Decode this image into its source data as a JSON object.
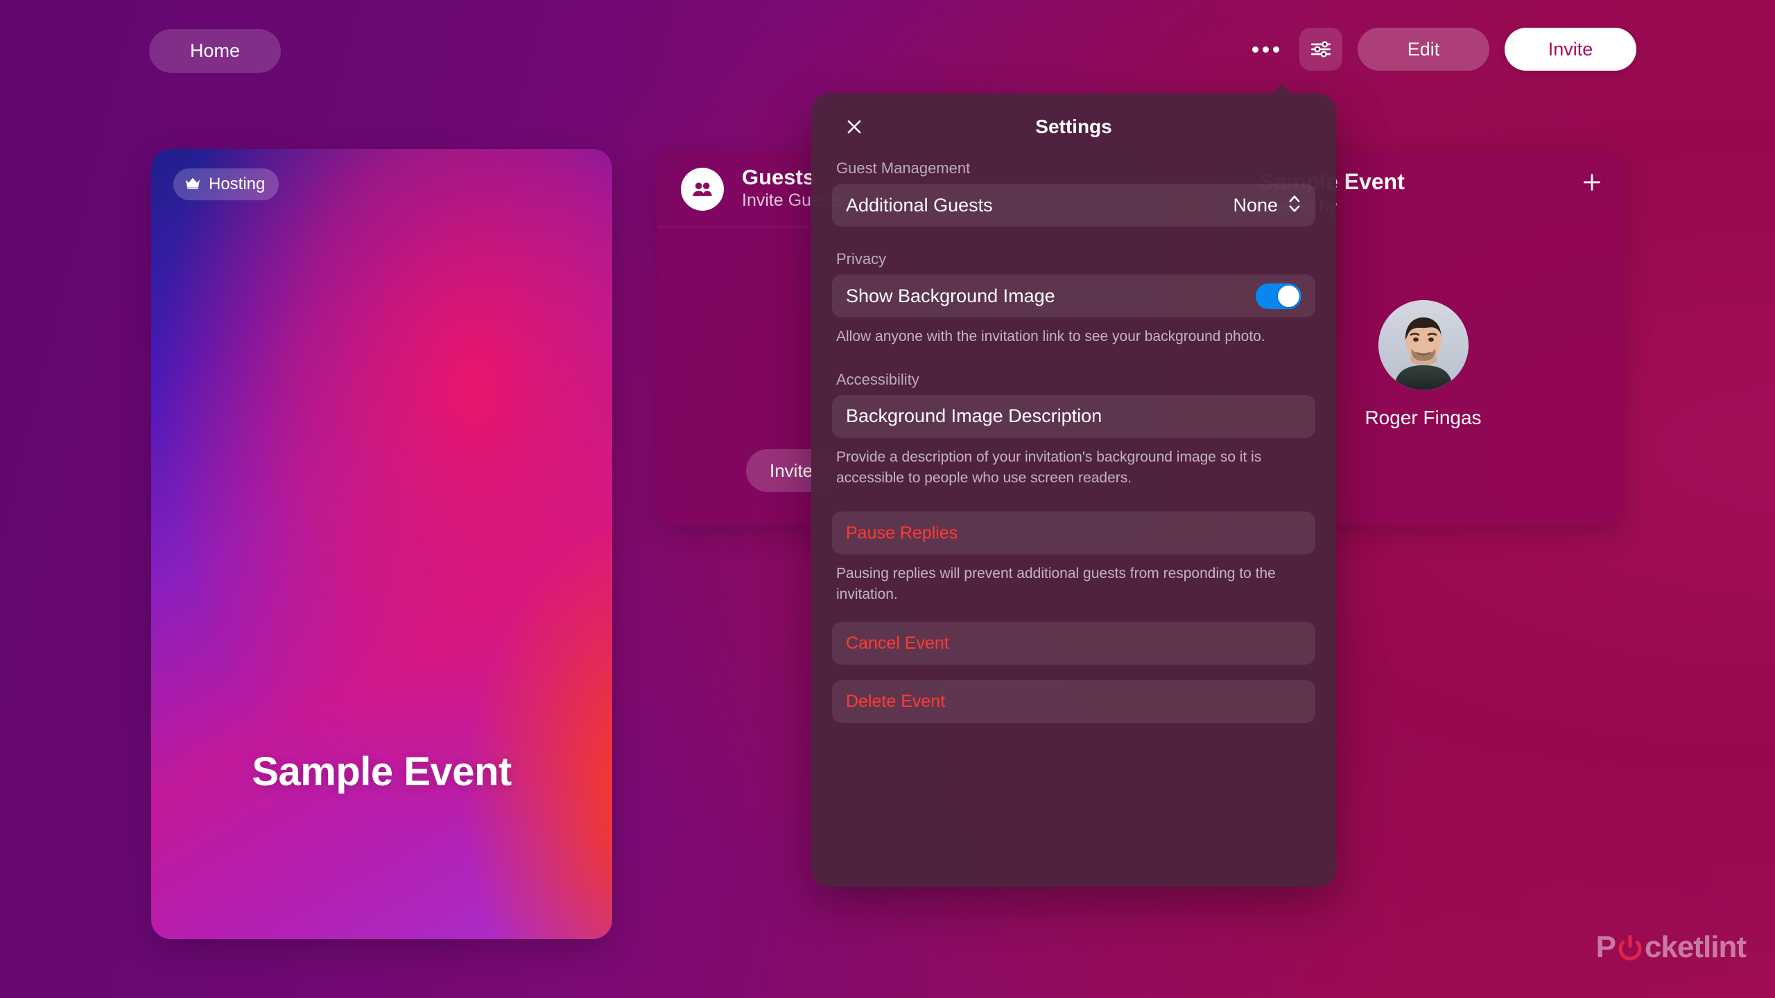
{
  "topbar": {
    "home_label": "Home",
    "more_icon": "ellipsis-icon",
    "sliders_icon": "sliders-icon",
    "edit_label": "Edit",
    "invite_label": "Invite"
  },
  "event_card": {
    "badge_label": "Hosting",
    "badge_icon": "crown-icon",
    "title": "Sample Event"
  },
  "guests_card": {
    "icon": "people-icon",
    "title": "Guests",
    "subtitle": "Invite Guests",
    "cta_label": "Invite"
  },
  "right_card": {
    "title": "Sample Event",
    "subtitle": "Hosted by",
    "add_icon": "plus-icon",
    "host_name": "Roger Fingas"
  },
  "settings_panel": {
    "title": "Settings",
    "close_icon": "close-icon",
    "sections": {
      "guest_management": {
        "label": "Guest Management",
        "row_label": "Additional Guests",
        "row_value": "None",
        "stepper_icon": "chevron-up-down-icon"
      },
      "privacy": {
        "label": "Privacy",
        "row_label": "Show Background Image",
        "toggle_state": "on",
        "helper": "Allow anyone with the invitation link to see your background photo."
      },
      "accessibility": {
        "label": "Accessibility",
        "row_label": "Background Image Description",
        "helper": "Provide a description of your invitation's background image so it is accessible to people who use screen readers."
      }
    },
    "actions": {
      "pause_replies": "Pause Replies",
      "pause_helper": "Pausing replies will prevent additional guests from responding to the invitation.",
      "cancel_event": "Cancel Event",
      "delete_event": "Delete Event"
    }
  },
  "watermark": {
    "text_before": "P",
    "text_after": "cketlint"
  },
  "colors": {
    "page_gradient_start": "#640670",
    "page_gradient_end": "#a30e57",
    "toggle_on": "#0a86f0",
    "danger": "#ff3b30",
    "invite_text": "#a5105c",
    "panel_bg": "#4d233e",
    "watermark_accent": "#e0254a"
  }
}
